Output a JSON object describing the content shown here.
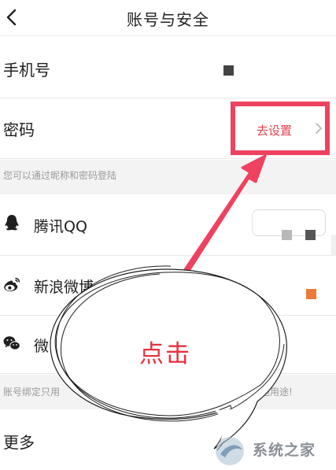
{
  "header": {
    "title": "账号与安全",
    "back_icon": "chevron-left-icon"
  },
  "phone": {
    "label": "手机号",
    "mask_colors": [
      "#444444"
    ]
  },
  "password": {
    "label": "密码",
    "action": "去设置",
    "action_color": "#e8414d",
    "icon": "chevron-right-icon"
  },
  "note_login": "您可以通过昵称和密码登陆",
  "social": [
    {
      "label": "腾讯QQ",
      "icon": "qq-penguin-icon"
    },
    {
      "label": "新浪微博",
      "icon": "weibo-icon"
    },
    {
      "label": "微",
      "icon": "wechat-icon"
    }
  ],
  "note_binding": {
    "left": "账号绑定只用",
    "right": "作其他用途!"
  },
  "more": {
    "label": "更多"
  },
  "annotation": {
    "text": "点击",
    "color": "#e8303e",
    "highlight_color": "#ee4260"
  },
  "watermark": {
    "text": "系统之家"
  }
}
